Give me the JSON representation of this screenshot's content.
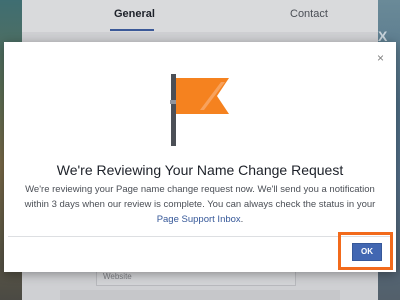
{
  "background": {
    "tabs": {
      "general": "General",
      "contact": "Contact"
    },
    "website_placeholder": "Website",
    "right_letters": "X U"
  },
  "modal": {
    "close_label": "×",
    "flag_icon": "flag-icon",
    "title": "We're Reviewing Your Name Change Request",
    "body_text": "We're reviewing your Page name change request now. We'll send you a notification within 3 days when our review is complete. You can always check the status in your",
    "body_link": "Page Support Inbox",
    "body_end": ".",
    "ok_label": "OK"
  },
  "colors": {
    "accent": "#4267b2",
    "flag_orange": "#f5821f",
    "highlight": "#f26a1b"
  }
}
